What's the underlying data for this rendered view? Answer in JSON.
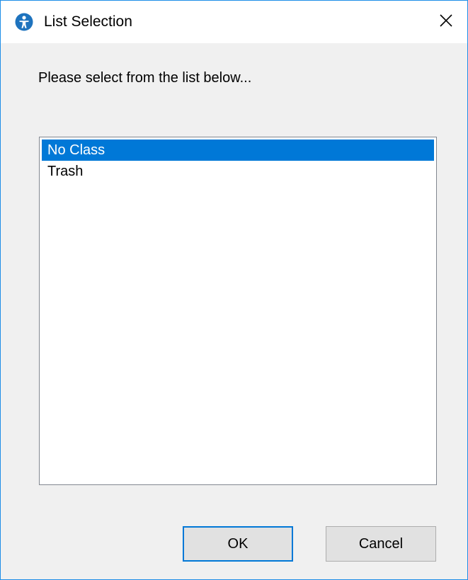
{
  "window": {
    "title": "List Selection",
    "accent_color": "#1e8ee8",
    "app_icon": "person-circle-icon",
    "close_icon": "close-icon"
  },
  "prompt": "Please select from the list below...",
  "list": {
    "items": [
      {
        "label": "No Class",
        "selected": true
      },
      {
        "label": "Trash",
        "selected": false
      }
    ],
    "selection_color": "#0078d7"
  },
  "buttons": {
    "ok_label": "OK",
    "cancel_label": "Cancel"
  }
}
